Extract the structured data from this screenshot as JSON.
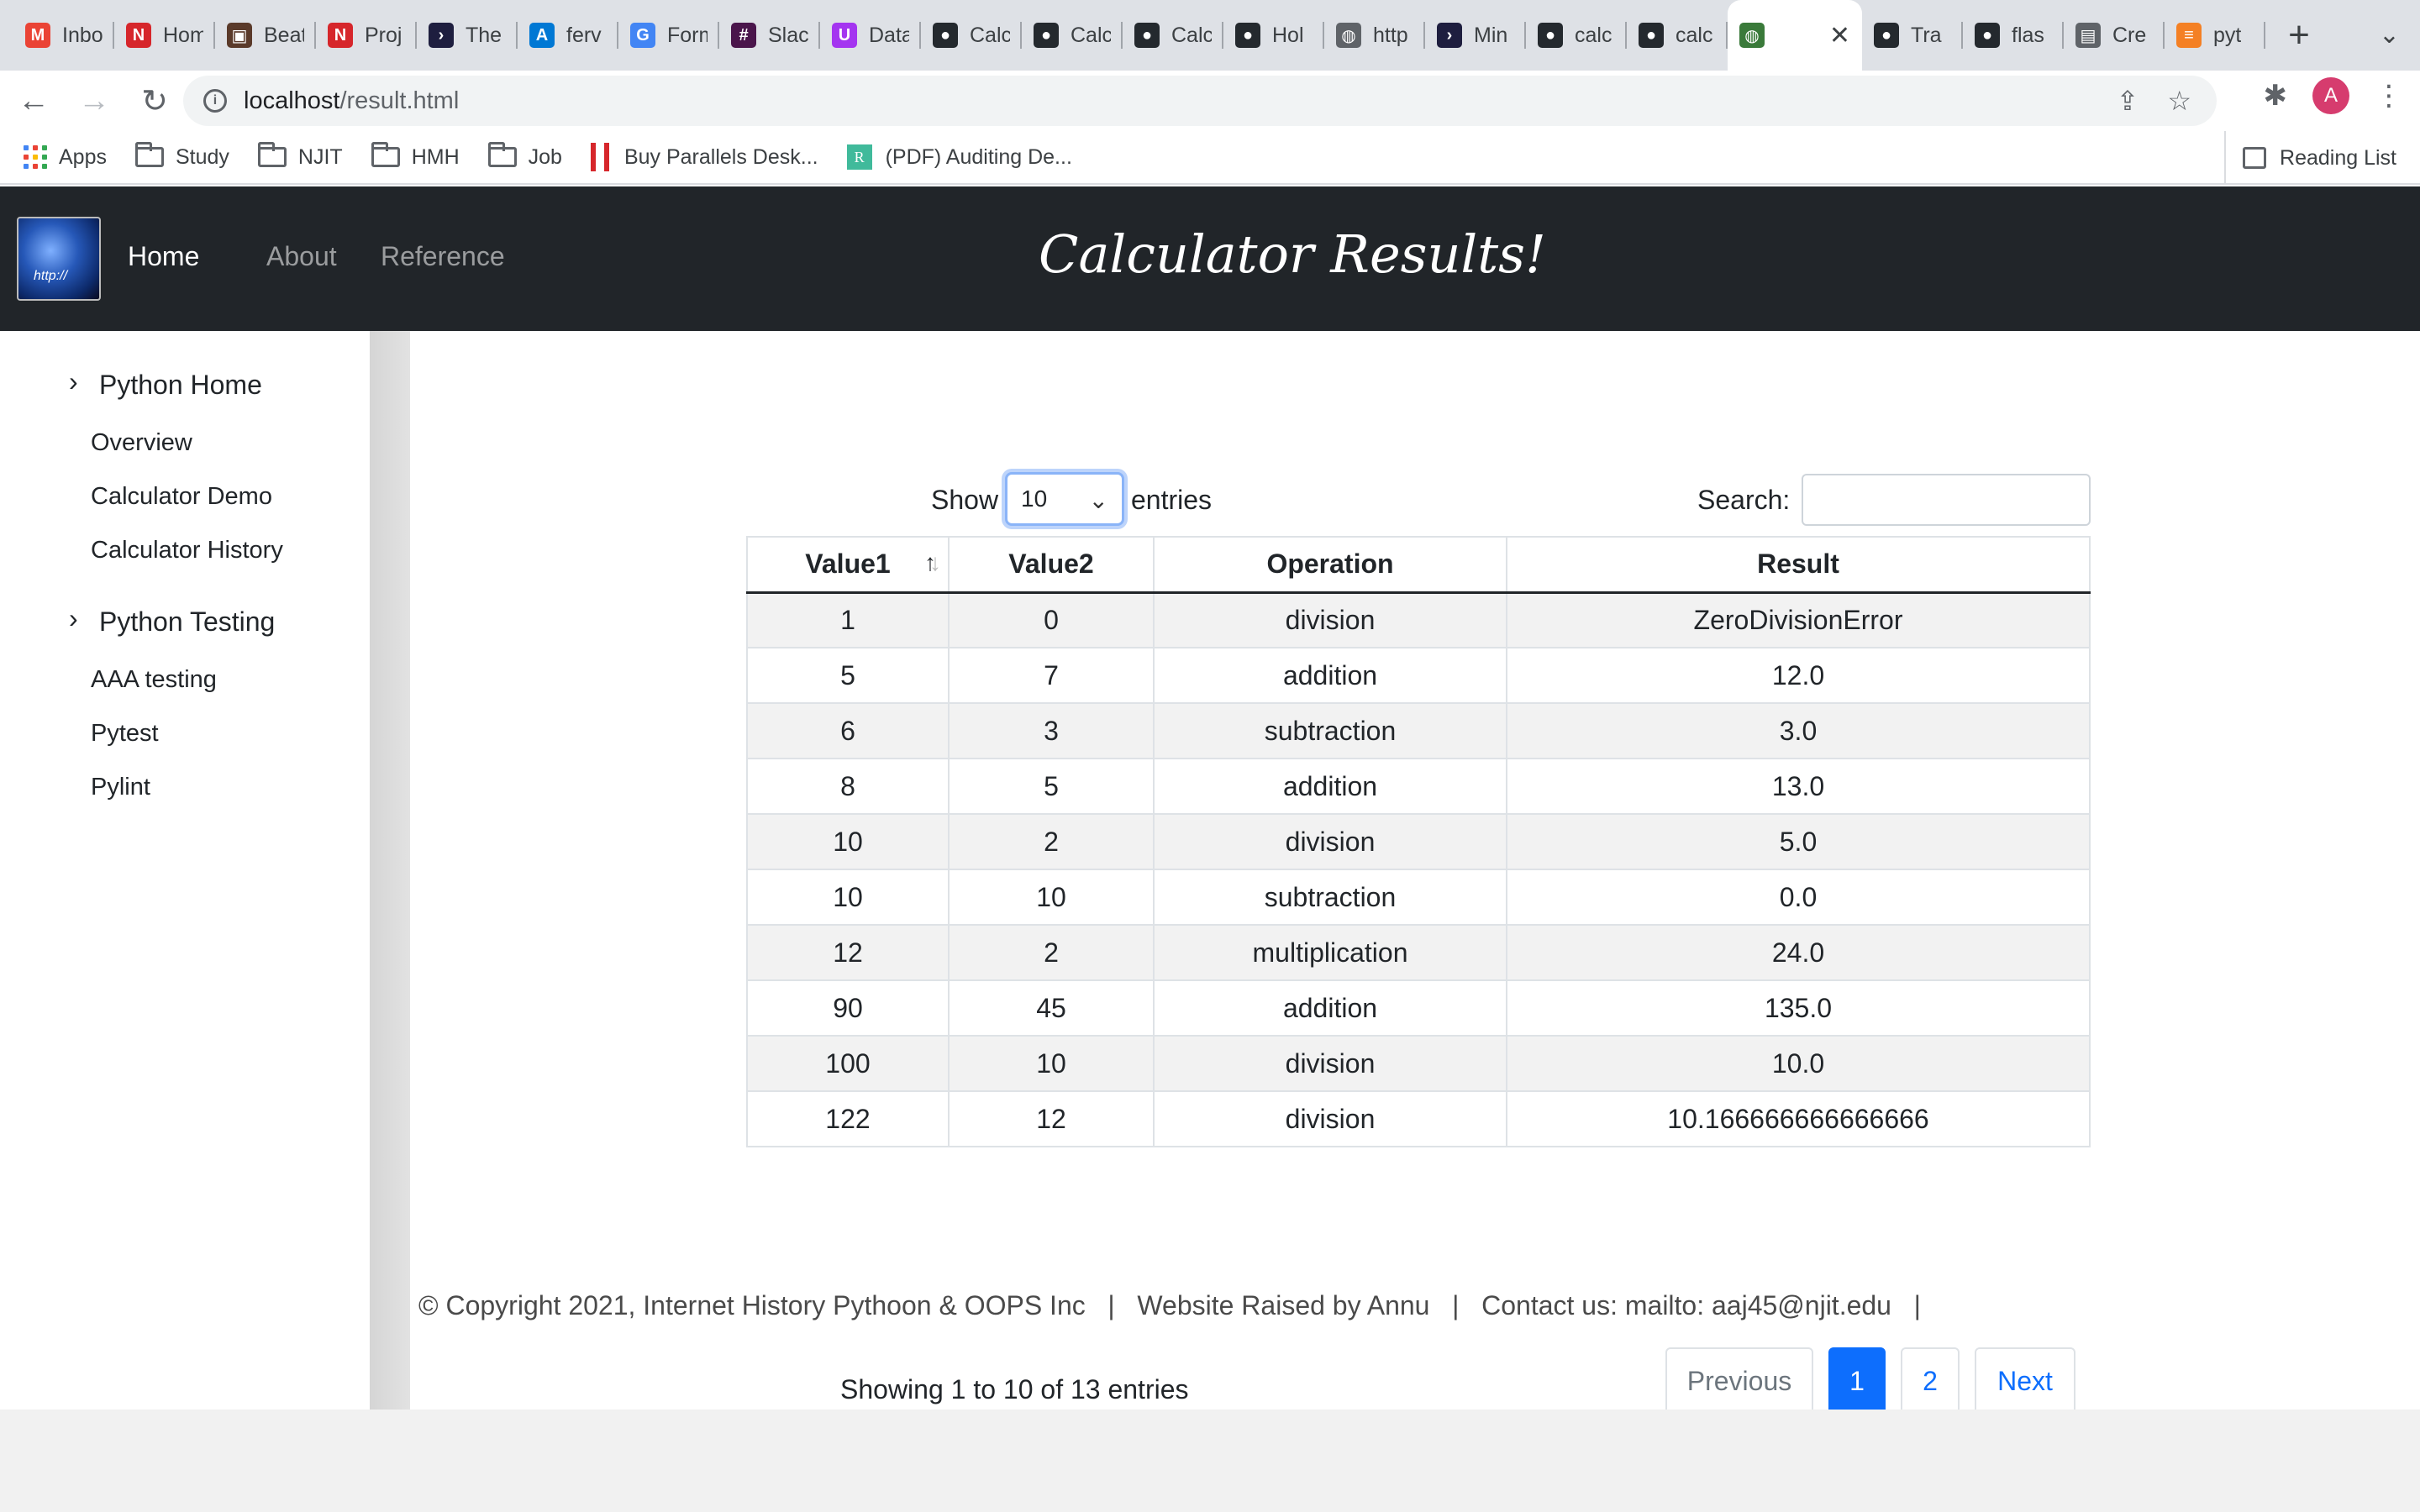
{
  "browser": {
    "tabs": [
      {
        "title": "Inbox",
        "icon": "gmail-icon",
        "color": "#ea4335"
      },
      {
        "title": "Home",
        "icon": "njit-icon",
        "color": "#d6262b"
      },
      {
        "title": "Beat",
        "icon": "photo-icon",
        "color": "#5a3a2a"
      },
      {
        "title": "Proj",
        "icon": "njit-icon",
        "color": "#d6262b"
      },
      {
        "title": "The",
        "icon": "terminal-icon",
        "color": "#1e1e3f"
      },
      {
        "title": "ferv",
        "icon": "azure-icon",
        "color": "#0078d4"
      },
      {
        "title": "Form",
        "icon": "google-forms-icon",
        "color": "#4285f4"
      },
      {
        "title": "Slack",
        "icon": "slack-icon",
        "color": "#4a154b"
      },
      {
        "title": "Data",
        "icon": "udemy-icon",
        "color": "#a435f0"
      },
      {
        "title": "Calc",
        "icon": "github-icon",
        "color": "#24292e"
      },
      {
        "title": "Calc",
        "icon": "github-icon",
        "color": "#24292e"
      },
      {
        "title": "Calc",
        "icon": "github-icon",
        "color": "#24292e"
      },
      {
        "title": "Hol",
        "icon": "github-icon",
        "color": "#24292e"
      },
      {
        "title": "http",
        "icon": "globe-icon",
        "color": "#5f6368"
      },
      {
        "title": "Min",
        "icon": "terminal-icon",
        "color": "#1e1e3f"
      },
      {
        "title": "calc",
        "icon": "github-icon",
        "color": "#24292e"
      },
      {
        "title": "calc",
        "icon": "github-icon",
        "color": "#24292e"
      },
      {
        "title": "",
        "icon": "globe-icon",
        "color": "#3a7a3a",
        "active": true
      },
      {
        "title": "Tra",
        "icon": "github-icon",
        "color": "#24292e"
      },
      {
        "title": "flas",
        "icon": "github-icon",
        "color": "#24292e"
      },
      {
        "title": "Cre",
        "icon": "folder-icon",
        "color": "#5f6368"
      },
      {
        "title": "pyt",
        "icon": "stackoverflow-icon",
        "color": "#f48024"
      }
    ],
    "url_host": "localhost",
    "url_path": "/result.html",
    "avatar_letter": "A",
    "bookmarks": [
      "Apps",
      "Study",
      "NJIT",
      "HMH",
      "Job",
      "Buy Parallels Desk...",
      "(PDF) Auditing De..."
    ],
    "reading_list": "Reading List"
  },
  "nav": {
    "home": "Home",
    "about": "About",
    "reference": "Reference",
    "brand": "Calculator Results!"
  },
  "sidebar": {
    "sections": [
      {
        "title": "Python Home",
        "items": [
          "Overview",
          "Calculator Demo",
          "Calculator History"
        ]
      },
      {
        "title": "Python Testing",
        "items": [
          "AAA testing",
          "Pytest",
          "Pylint"
        ]
      }
    ]
  },
  "controls": {
    "show_label": "Show",
    "entries_value": "10",
    "entries_label": "entries",
    "search_label": "Search:",
    "search_value": ""
  },
  "table": {
    "columns": [
      "Value1",
      "Value2",
      "Operation",
      "Result"
    ],
    "rows": [
      [
        "1",
        "0",
        "division",
        "ZeroDivisionError"
      ],
      [
        "5",
        "7",
        "addition",
        "12.0"
      ],
      [
        "6",
        "3",
        "subtraction",
        "3.0"
      ],
      [
        "8",
        "5",
        "addition",
        "13.0"
      ],
      [
        "10",
        "2",
        "division",
        "5.0"
      ],
      [
        "10",
        "10",
        "subtraction",
        "0.0"
      ],
      [
        "12",
        "2",
        "multiplication",
        "24.0"
      ],
      [
        "90",
        "45",
        "addition",
        "135.0"
      ],
      [
        "100",
        "10",
        "division",
        "10.0"
      ],
      [
        "122",
        "12",
        "division",
        "10.166666666666666"
      ]
    ]
  },
  "pagination": {
    "info": "Showing 1 to 10 of 13 entries",
    "previous": "Previous",
    "pages": [
      "1",
      "2"
    ],
    "current": "1",
    "next": "Next"
  },
  "footer": {
    "text": "© Copyright 2021, Internet History Pythoon & OOPS Inc   |   Website Raised by Annu   |   Contact us: mailto: aaj45@njit.edu   |"
  }
}
